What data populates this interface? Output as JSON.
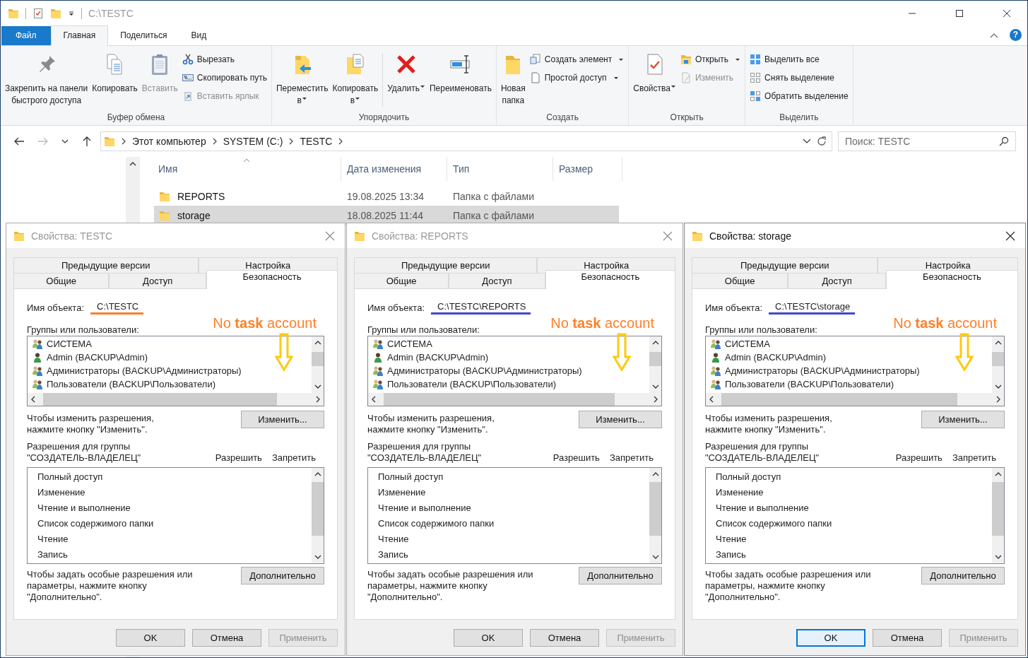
{
  "window": {
    "title": "C:\\TESTC"
  },
  "ribbon": {
    "tabs": [
      {
        "label": "Файл",
        "kind": "file",
        "selected": false
      },
      {
        "label": "Главная",
        "kind": "tab",
        "selected": true
      },
      {
        "label": "Поделиться",
        "kind": "tab",
        "selected": false
      },
      {
        "label": "Вид",
        "kind": "tab",
        "selected": false
      }
    ],
    "help": "?",
    "groups": [
      {
        "label": "Буфер обмена",
        "items": [
          {
            "kind": "large",
            "label": "Закрепить на панели\nбыстрого доступа",
            "disabled": false,
            "dropdown": false
          },
          {
            "kind": "large",
            "label": "Копировать",
            "disabled": false,
            "dropdown": false
          },
          {
            "kind": "large",
            "label": "Вставить",
            "disabled": true,
            "dropdown": false
          },
          {
            "kind": "small",
            "label": "Вырезать",
            "disabled": false,
            "dropdown": false
          },
          {
            "kind": "small",
            "label": "Скопировать путь",
            "disabled": false,
            "dropdown": false
          },
          {
            "kind": "small",
            "label": "Вставить ярлык",
            "disabled": true,
            "dropdown": false
          }
        ]
      },
      {
        "label": "Упорядочить",
        "items": [
          {
            "kind": "large",
            "label": "Переместить\nв",
            "disabled": false,
            "dropdown": true
          },
          {
            "kind": "large",
            "label": "Копировать\nв",
            "disabled": false,
            "dropdown": true
          },
          {
            "kind": "separator"
          },
          {
            "kind": "large",
            "label": "Удалить",
            "disabled": false,
            "dropdown": true
          },
          {
            "kind": "large",
            "label": "Переименовать",
            "disabled": false,
            "dropdown": false
          }
        ]
      },
      {
        "label": "Создать",
        "items": [
          {
            "kind": "large",
            "label": "Новая\nпапка",
            "disabled": false,
            "dropdown": false
          },
          {
            "kind": "small",
            "label": "Создать элемент",
            "disabled": false,
            "dropdown": true
          },
          {
            "kind": "small",
            "label": "Простой доступ",
            "disabled": false,
            "dropdown": true
          }
        ]
      },
      {
        "label": "Открыть",
        "items": [
          {
            "kind": "large",
            "label": "Свойства",
            "disabled": false,
            "dropdown": true
          },
          {
            "kind": "small",
            "label": "Открыть",
            "disabled": false,
            "dropdown": true
          },
          {
            "kind": "small",
            "label": "Изменить",
            "disabled": true,
            "dropdown": false
          }
        ]
      },
      {
        "label": "Выделить",
        "items": [
          {
            "kind": "small",
            "label": "Выделить все",
            "disabled": false,
            "dropdown": false
          },
          {
            "kind": "small",
            "label": "Снять выделение",
            "disabled": false,
            "dropdown": false
          },
          {
            "kind": "small",
            "label": "Обратить выделение",
            "disabled": false,
            "dropdown": false
          }
        ]
      }
    ]
  },
  "address": {
    "segments": [
      "Этот компьютер",
      "SYSTEM (C:)",
      "TESTC"
    ]
  },
  "search": {
    "placeholder": "Поиск: TESTC"
  },
  "file_list": {
    "columns": [
      {
        "label": "Имя",
        "sorted": true
      },
      {
        "label": "Дата изменения",
        "sorted": false
      },
      {
        "label": "Тип",
        "sorted": false
      },
      {
        "label": "Размер",
        "sorted": false
      }
    ],
    "rows": [
      {
        "name": "REPORTS",
        "date": "19.08.2025 13:34",
        "type": "Папка с файлами",
        "selected": false
      },
      {
        "name": "storage",
        "date": "18.08.2025 11:44",
        "type": "Папка с файлами",
        "selected": true
      }
    ]
  },
  "dialogs": [
    {
      "title": "Свойства: TESTC",
      "active": false,
      "tab_rows": [
        {
          "tabs": [
            {
              "label": "Предыдущие версии",
              "selected": false
            },
            {
              "label": "Настройка",
              "selected": false
            }
          ]
        },
        {
          "tabs": [
            {
              "label": "Общие",
              "selected": false
            },
            {
              "label": "Доступ",
              "selected": false
            },
            {
              "label": "Безопасность",
              "selected": true
            }
          ]
        }
      ],
      "object_label": "Имя объекта:",
      "object_name": {
        "text": "C:\\TESTC",
        "color": "#ff7f27"
      },
      "groups_label": "Группы или пользователи:",
      "principals": [
        {
          "kind": "group",
          "name": "СИСТЕМА"
        },
        {
          "kind": "user",
          "name": "Admin (BACKUP\\Admin)"
        },
        {
          "kind": "group",
          "name": "Администраторы (BACKUP\\Администраторы)"
        },
        {
          "kind": "group",
          "name": "Пользователи (BACKUP\\Пользователи)"
        }
      ],
      "change_hint": "Чтобы изменить разрешения,\nнажмите кнопку \"Изменить\".",
      "change_button": "Изменить...",
      "permissions_label": "Разрешения для группы\n\"СОЗДАТЕЛЬ-ВЛАДЕЛЕЦ\"",
      "allow_header": "Разрешить",
      "deny_header": "Запретить",
      "permissions": [
        "Полный доступ",
        "Изменение",
        "Чтение и выполнение",
        "Список содержимого папки",
        "Чтение",
        "Запись"
      ],
      "advanced_hint": "Чтобы задать особые разрешения или\nпараметры, нажмите кнопку\n\"Дополнительно\".",
      "advanced_button": "Дополнительно",
      "buttons": [
        {
          "label": "OK",
          "focused": false,
          "disabled": false
        },
        {
          "label": "Отмена",
          "focused": false,
          "disabled": false
        },
        {
          "label": "Применить",
          "focused": false,
          "disabled": true
        }
      ],
      "annotation": "No **task** account"
    },
    {
      "title": "Свойства: REPORTS",
      "active": false,
      "tab_rows": [
        {
          "tabs": [
            {
              "label": "Предыдущие версии",
              "selected": false
            },
            {
              "label": "Настройка",
              "selected": false
            }
          ]
        },
        {
          "tabs": [
            {
              "label": "Общие",
              "selected": false
            },
            {
              "label": "Доступ",
              "selected": false
            },
            {
              "label": "Безопасность",
              "selected": true
            }
          ]
        }
      ],
      "object_label": "Имя объекта:",
      "object_name": {
        "text": "C:\\TESTC\\REPORTS",
        "color": "#3f48cc"
      },
      "groups_label": "Группы или пользователи:",
      "principals": [
        {
          "kind": "group",
          "name": "СИСТЕМА"
        },
        {
          "kind": "user",
          "name": "Admin (BACKUP\\Admin)"
        },
        {
          "kind": "group",
          "name": "Администраторы (BACKUP\\Администраторы)"
        },
        {
          "kind": "group",
          "name": "Пользователи (BACKUP\\Пользователи)"
        }
      ],
      "change_hint": "Чтобы изменить разрешения,\nнажмите кнопку \"Изменить\".",
      "change_button": "Изменить...",
      "permissions_label": "Разрешения для группы\n\"СОЗДАТЕЛЬ-ВЛАДЕЛЕЦ\"",
      "allow_header": "Разрешить",
      "deny_header": "Запретить",
      "permissions": [
        "Полный доступ",
        "Изменение",
        "Чтение и выполнение",
        "Список содержимого папки",
        "Чтение",
        "Запись"
      ],
      "advanced_hint": "Чтобы задать особые разрешения или\nпараметры, нажмите кнопку\n\"Дополнительно\".",
      "advanced_button": "Дополнительно",
      "buttons": [
        {
          "label": "OK",
          "focused": false,
          "disabled": false
        },
        {
          "label": "Отмена",
          "focused": false,
          "disabled": false
        },
        {
          "label": "Применить",
          "focused": false,
          "disabled": true
        }
      ],
      "annotation": "No **task** account"
    },
    {
      "title": "Свойства: storage",
      "active": true,
      "tab_rows": [
        {
          "tabs": [
            {
              "label": "Предыдущие версии",
              "selected": false
            },
            {
              "label": "Настройка",
              "selected": false
            }
          ]
        },
        {
          "tabs": [
            {
              "label": "Общие",
              "selected": false
            },
            {
              "label": "Доступ",
              "selected": false
            },
            {
              "label": "Безопасность",
              "selected": true
            }
          ]
        }
      ],
      "object_label": "Имя объекта:",
      "object_name": {
        "text": "C:\\TESTC\\storage",
        "color": "#3f48cc"
      },
      "groups_label": "Группы или пользователи:",
      "principals": [
        {
          "kind": "group",
          "name": "СИСТЕМА"
        },
        {
          "kind": "user",
          "name": "Admin (BACKUP\\Admin)"
        },
        {
          "kind": "group",
          "name": "Администраторы (BACKUP\\Администраторы)"
        },
        {
          "kind": "group",
          "name": "Пользователи (BACKUP\\Пользователи)"
        }
      ],
      "change_hint": "Чтобы изменить разрешения,\nнажмите кнопку \"Изменить\".",
      "change_button": "Изменить...",
      "permissions_label": "Разрешения для группы\n\"СОЗДАТЕЛЬ-ВЛАДЕЛЕЦ\"",
      "allow_header": "Разрешить",
      "deny_header": "Запретить",
      "permissions": [
        "Полный доступ",
        "Изменение",
        "Чтение и выполнение",
        "Список содержимого папки",
        "Чтение",
        "Запись"
      ],
      "advanced_hint": "Чтобы задать особые разрешения или\nпараметры, нажмите кнопку\n\"Дополнительно\".",
      "advanced_button": "Дополнительно",
      "buttons": [
        {
          "label": "OK",
          "focused": true,
          "disabled": false
        },
        {
          "label": "Отмена",
          "focused": false,
          "disabled": false
        },
        {
          "label": "Применить",
          "focused": false,
          "disabled": true
        }
      ],
      "annotation": "No **task** account"
    }
  ]
}
